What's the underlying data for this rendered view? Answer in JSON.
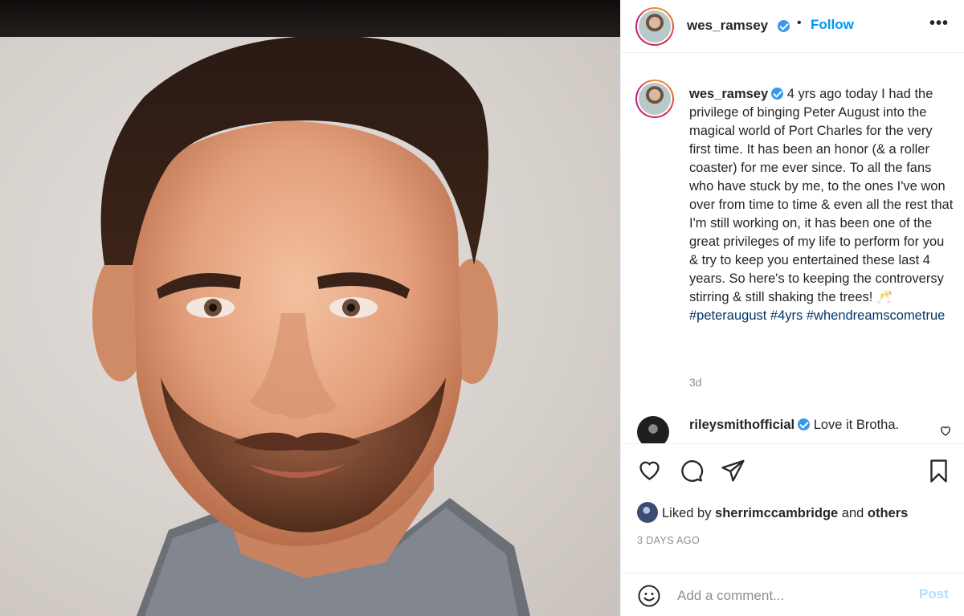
{
  "post": {
    "username": "wes_ramsey",
    "follow_label": "Follow",
    "dot": "•",
    "more_label": "•••"
  },
  "caption": {
    "username": "wes_ramsey",
    "text": " 4 yrs ago today I had the privilege of binging Peter August into the magical world of Port Charles for the very first time. It has been an honor (& a roller coaster) for me ever since. To all the fans who have stuck by me, to the ones I've won over from time to time & even all the rest that I'm still working on, it has been one of the great privileges of my life to perform for you & try to keep you entertained these last 4 years. So here's to keeping the controversy stirring & still shaking the trees! 🥂",
    "hashtags": [
      "#peteraugust",
      "#4yrs",
      "#whendreamscometrue"
    ],
    "time": "3d"
  },
  "comment": {
    "username": "rileysmithofficial",
    "text": " Love it Brotha."
  },
  "likes": {
    "prefix": "Liked by ",
    "user": "sherrimccambridge",
    "middle": " and ",
    "others": "others"
  },
  "date": "3 DAYS AGO",
  "add_comment": {
    "placeholder": "Add a comment...",
    "post_label": "Post"
  },
  "colors": {
    "link": "#0095f6",
    "hashtag": "#00376b",
    "verified": "#3897f0",
    "muted": "#8e8e8e",
    "post_disabled": "#b2dffc"
  }
}
